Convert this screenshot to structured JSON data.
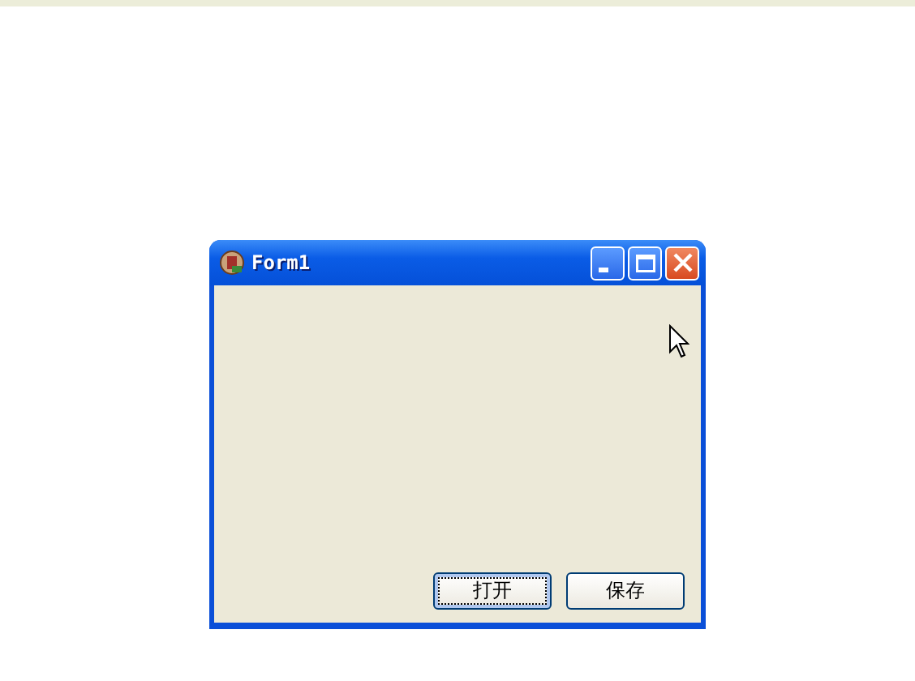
{
  "window": {
    "title": "Form1"
  },
  "buttons": [
    {
      "label": "打开",
      "focused": true
    },
    {
      "label": "保存",
      "focused": false
    }
  ]
}
